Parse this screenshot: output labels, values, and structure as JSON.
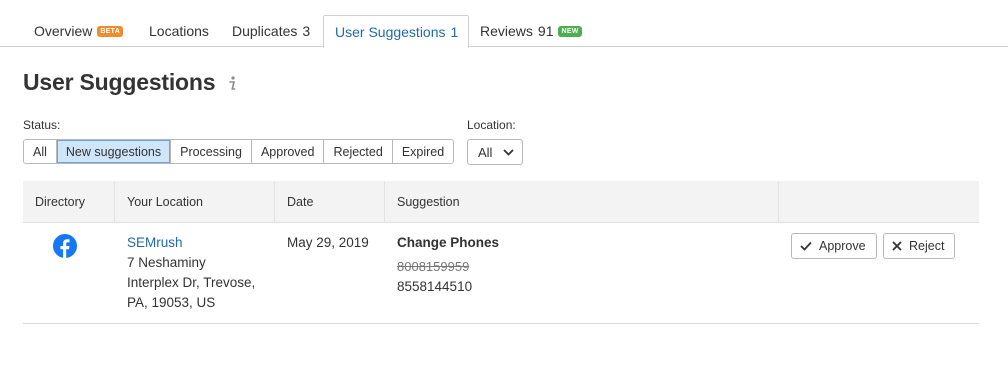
{
  "tabs": [
    {
      "label": "Overview",
      "badge": "BETA",
      "badge_color": "#f08c2e"
    },
    {
      "label": "Locations"
    },
    {
      "label": "Duplicates",
      "count": "3"
    },
    {
      "label": "User Suggestions",
      "count": "1",
      "active": true
    },
    {
      "label": "Reviews",
      "count": "91",
      "badge": "NEW",
      "badge_color": "#4caf50"
    }
  ],
  "page": {
    "title": "User Suggestions",
    "info_icon": "info-icon"
  },
  "filters": {
    "status_label": "Status:",
    "status_options": [
      "All",
      "New suggestions",
      "Processing",
      "Approved",
      "Rejected",
      "Expired"
    ],
    "status_selected": "New suggestions",
    "location_label": "Location:",
    "location_value": "All"
  },
  "table": {
    "columns": [
      "Directory",
      "Your Location",
      "Date",
      "Suggestion",
      ""
    ],
    "rows": [
      {
        "directory_icon": "facebook-icon",
        "location_name": "SEMrush",
        "address_line1": "7 Neshaminy",
        "address_line2": "Interplex Dr, Trevose,",
        "address_line3": "PA, 19053, US",
        "date": "May 29, 2019",
        "suggestion_title": "Change Phones",
        "old_value": "8008159959",
        "new_value": "8558144510",
        "approve_label": "Approve",
        "reject_label": "Reject"
      }
    ]
  },
  "colors": {
    "accent": "#1f6aa8",
    "facebook": "#1877f2",
    "selected_bg": "#cfe6fa"
  }
}
